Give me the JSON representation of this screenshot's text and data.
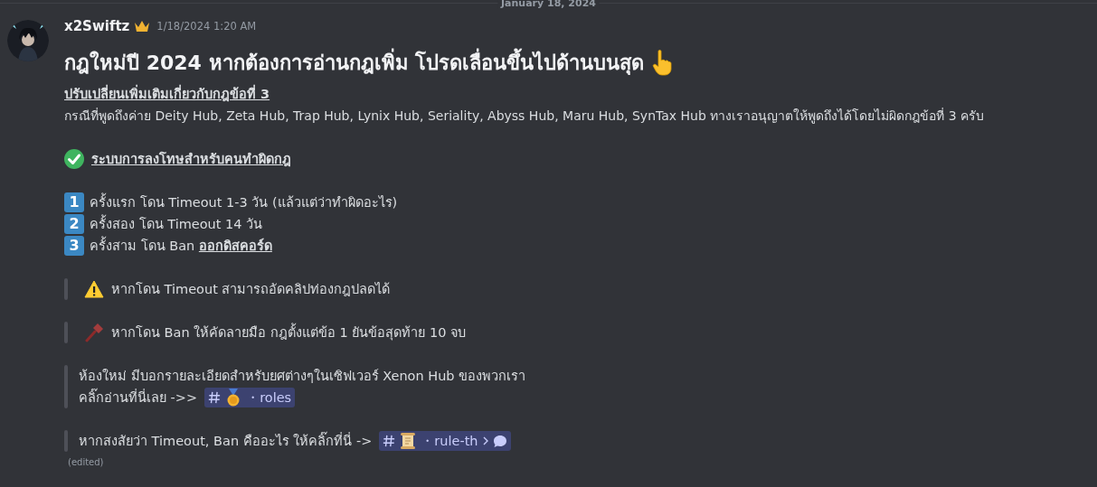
{
  "date_divider": "January 18, 2024",
  "message": {
    "author": "x2Swiftz",
    "timestamp": "1/18/2024 1:20 AM",
    "heading": "กฎใหม่ปี 2024 หากต้องการอ่านกฎเพิ่ม โปรดเลื่อนขึ้นไปด้านบนสุด",
    "blocks": [
      {
        "kind": "subheading",
        "text": "ปรับเปลี่ยนเพิ่มเติมเกี่ยวกับกฎข้อที่ 3"
      },
      {
        "kind": "paragraph",
        "text": "กรณีที่พูดถึงค่าย Deity Hub, Zeta Hub, Trap Hub, Lynix Hub, Seriality, Abyss Hub, Maru Hub, SynTax Hub ทางเราอนุญาตให้พูดถึงได้โดยไม่ผิดกฎข้อที่ 3 ครับ"
      },
      {
        "kind": "check_heading",
        "text": "ระบบการลงโทษสำหรับคนทำผิดกฎ"
      },
      {
        "kind": "numbered",
        "items": [
          {
            "number": "1",
            "text": "ครั้งแรก โดน Timeout 1-3 วัน (แล้วแต่ว่าทำผิดอะไร)"
          },
          {
            "number": "2",
            "text": "ครั้งสอง โดน Timeout 14 วัน"
          },
          {
            "number": "3",
            "text": "ครั้งสาม โดน Ban **ออกดิสคอร์ด**"
          }
        ]
      },
      {
        "kind": "quote",
        "lines": [
          {
            "kind": "warning",
            "text": "หากโดน Timeout สามารถอัดคลิปท่องกฎปลดได้"
          }
        ]
      },
      {
        "kind": "quote",
        "lines": [
          {
            "kind": "hammer",
            "text": "หากโดน Ban ให้คัดลายมือ กฎตั้งแต่ข้อ 1 ยันข้อสุดท้าย 10 จบ"
          }
        ]
      },
      {
        "kind": "quote",
        "lines": [
          {
            "text": "ห้องใหม่ มีบอกรายละเอียดสำหรับยศต่างๆในเซิฟเวอร์ Xenon Hub ของพวกเรา"
          },
          {
            "text": "คลิ๊กอ่านที่นี่เลย ->>",
            "mention": {
              "kind": "medal",
              "name": "・roles"
            }
          }
        ]
      },
      {
        "kind": "quote",
        "lines": [
          {
            "text": "หากสงสัยว่า Timeout, Ban คืออะไร ให้คลิ๊กที่นี่ ->",
            "mention": {
              "kind": "scroll",
              "name": "・rule-th",
              "thread": true
            }
          }
        ]
      }
    ],
    "edited": "(edited)"
  }
}
